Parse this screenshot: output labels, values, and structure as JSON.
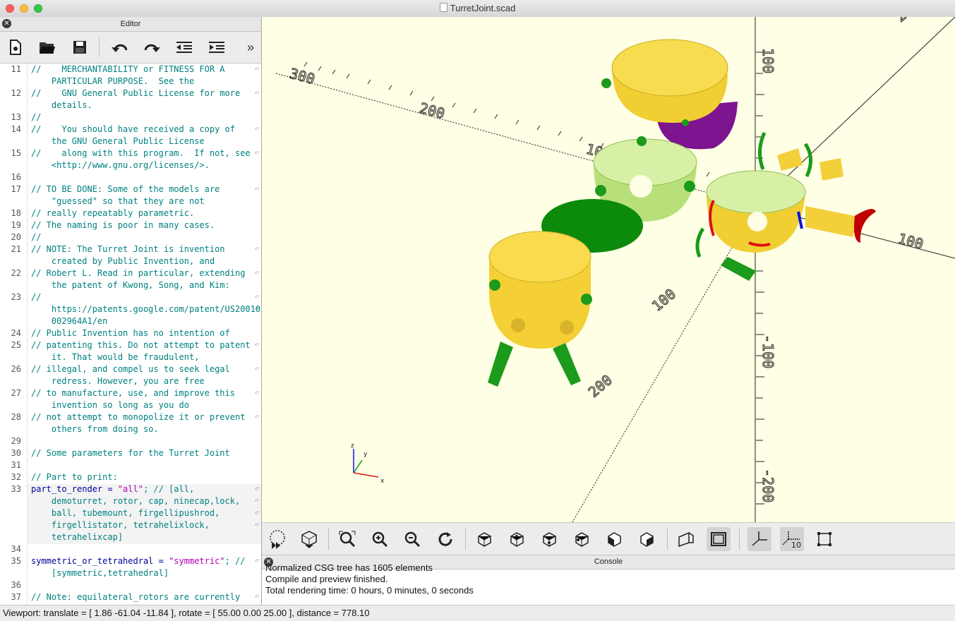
{
  "window": {
    "title": "TurretJoint.scad"
  },
  "editor": {
    "title": "Editor",
    "toolbar": [
      "new-file-icon",
      "open-file-icon",
      "save-icon",
      "undo-icon",
      "redo-icon",
      "unindent-icon",
      "indent-icon",
      "more-icon"
    ],
    "more_label": "»",
    "line_numbers": [
      "11",
      "12",
      "13",
      "14",
      "15",
      "16",
      "17",
      "18",
      "19",
      "20",
      "21",
      "22",
      "23",
      "24",
      "25",
      "26",
      "27",
      "28",
      "29",
      "30",
      "31",
      "32",
      "33",
      "34",
      "35",
      "36",
      "37"
    ],
    "lines": [
      "//    MERCHANTABILITY or FITNESS FOR A",
      "    PARTICULAR PURPOSE.  See the",
      "//    GNU General Public License for more",
      "    details.",
      "//",
      "//    You should have received a copy of",
      "    the GNU General Public License",
      "//    along with this program.  If not, see",
      "    <http://www.gnu.org/licenses/>.",
      "// TO BE DONE: Some of the models are",
      "    \"guessed\" so that they are not",
      "// really repeatably parametric.",
      "// The naming is poor in many cases.",
      "//",
      "// NOTE: The Turret Joint is invention",
      "    created by Public Invention, and",
      "// Robert L. Read in particular, extending",
      "    the patent of Kwong, Song, and Kim:",
      "//",
      "    https://patents.google.com/patent/US20010",
      "    002964A1/en",
      "// Public Invention has no intention of",
      "// patenting this. Do not attempt to patent",
      "    it. That would be fraudulent,",
      "// illegal, and compel us to seek legal",
      "    redress. However, you are free",
      "// to manufacture, use, and improve this",
      "    invention so long as you do",
      "// not attempt to monopolize it or prevent",
      "    others from doing so.",
      "// Some parameters for the Turret Joint",
      "// Part to print:",
      "part_to_render = ",
      "\"all\"",
      "; // [all,",
      "    demoturret, rotor, cap, ninecap,lock,",
      "    ball, tubemount, firgellipushrod,",
      "    firgellistator, tetrahelixlock,",
      "    tetrahelixcap]",
      "symmetric_or_tetrahedral = ",
      "\"symmetric\"",
      "; //",
      "    [symmetric,tetrahedral]",
      "// Note: equilateral_rotors are currently"
    ]
  },
  "viewport": {
    "axis_labels": [
      "300",
      "200",
      "100",
      "100",
      "100",
      "200",
      "100",
      "200",
      "-100",
      "-200"
    ],
    "gizmo": {
      "x": "x",
      "y": "y",
      "z": "z"
    },
    "toolbar": [
      "preview-icon",
      "render-icon",
      "view-all-icon",
      "zoom-in-icon",
      "zoom-out-icon",
      "reset-view-icon",
      "view-right-icon",
      "view-top-icon",
      "view-bottom-icon",
      "view-left-icon",
      "view-front-icon",
      "view-back-icon",
      "perspective-icon",
      "orthogonal-icon",
      "show-axes-icon",
      "show-scale-icon",
      "show-edges-icon"
    ],
    "scale_label": "10"
  },
  "console": {
    "title": "Console",
    "lines": [
      "Normalized CSG tree has 1605 elements",
      "Compile and preview finished.",
      "Total rendering time: 0 hours, 0 minutes, 0 seconds"
    ]
  },
  "status": "Viewport: translate = [ 1.86 -61.04 -11.84 ], rotate = [ 55.00 0.00 25.00 ], distance = 778.10",
  "colors": {
    "yellow": "#f8d844",
    "lightgreen": "#c4ea8a",
    "green": "#1b9a1b",
    "purple": "#8e1e9a",
    "viewport_bg": "#ffffe5"
  }
}
